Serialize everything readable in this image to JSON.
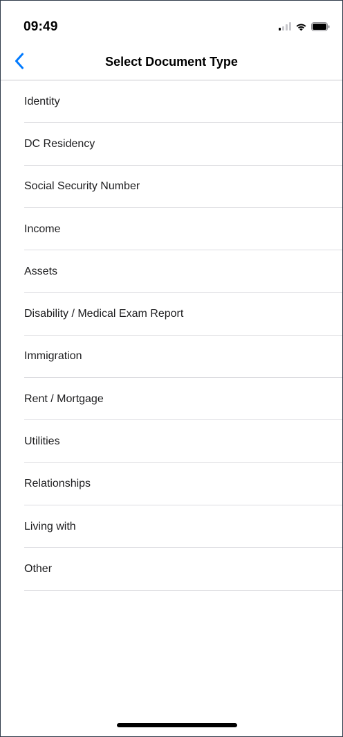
{
  "status_bar": {
    "time": "09:49",
    "icons": [
      "cellular-signal-icon",
      "wifi-icon",
      "battery-icon"
    ]
  },
  "nav": {
    "title": "Select Document Type",
    "back_icon": "chevron-left-icon",
    "accent_color": "#007aff"
  },
  "document_types": [
    {
      "label": "Identity"
    },
    {
      "label": "DC Residency"
    },
    {
      "label": "Social Security Number"
    },
    {
      "label": "Income"
    },
    {
      "label": "Assets"
    },
    {
      "label": "Disability / Medical Exam Report"
    },
    {
      "label": "Immigration"
    },
    {
      "label": "Rent / Mortgage"
    },
    {
      "label": "Utilities"
    },
    {
      "label": "Relationships"
    },
    {
      "label": "Living with"
    },
    {
      "label": "Other"
    }
  ]
}
